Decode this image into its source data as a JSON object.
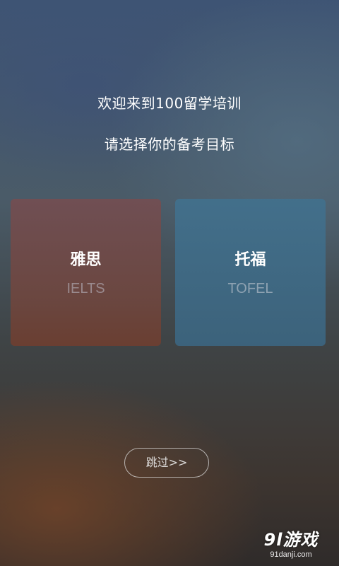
{
  "header": {
    "welcome": "欢迎来到100留学培训",
    "subtitle": "请选择你的备考目标"
  },
  "options": [
    {
      "title": "雅思",
      "subtitle": "IELTS",
      "color": "#6e4e50"
    },
    {
      "title": "托福",
      "subtitle": "TOFEL",
      "color": "#42708c"
    }
  ],
  "skip_label": "跳过>>",
  "watermark": {
    "logo": "9l游戏",
    "url": "91danji.com"
  }
}
